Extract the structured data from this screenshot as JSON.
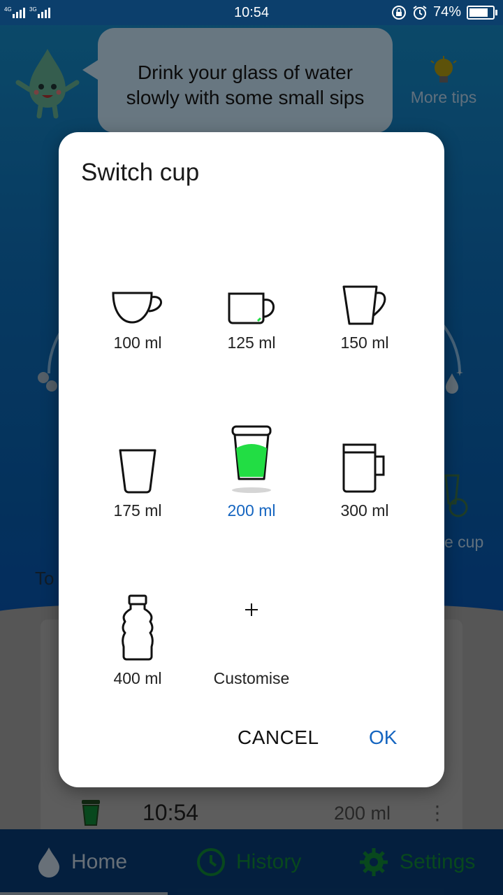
{
  "status_bar": {
    "network": "4G 3G",
    "time": "10:54",
    "battery_percent": "74%",
    "battery_level": 0.74
  },
  "background": {
    "tip_text": "Drink your glass of water slowly with some small sips",
    "tip_line_1": "Drink your glass of water",
    "tip_line_2": "slowly with some small sips",
    "more_tips_label": "More tips",
    "switch_cup_partial": "e cup",
    "today_partial": "To",
    "record": {
      "time": "10:54",
      "volume": "200 ml"
    },
    "nav": {
      "home": "Home",
      "history": "History",
      "settings": "Settings"
    }
  },
  "dialog": {
    "title": "Switch cup",
    "options": [
      {
        "label": "100 ml",
        "icon": "teacup-icon"
      },
      {
        "label": "125 ml",
        "icon": "mug-icon"
      },
      {
        "label": "150 ml",
        "icon": "tall-mug-icon"
      },
      {
        "label": "175 ml",
        "icon": "glass-icon"
      },
      {
        "label": "200 ml",
        "icon": "takeaway-cup-icon",
        "selected": true
      },
      {
        "label": "300 ml",
        "icon": "beer-mug-icon"
      },
      {
        "label": "400 ml",
        "icon": "bottle-icon"
      },
      {
        "label": "Customise",
        "icon": "plus-icon"
      }
    ],
    "cancel_label": "CANCEL",
    "ok_label": "OK"
  },
  "colors": {
    "accent": "#1565c0",
    "selected_fill": "#22dd44",
    "nav_active": "#0c6a2c"
  }
}
